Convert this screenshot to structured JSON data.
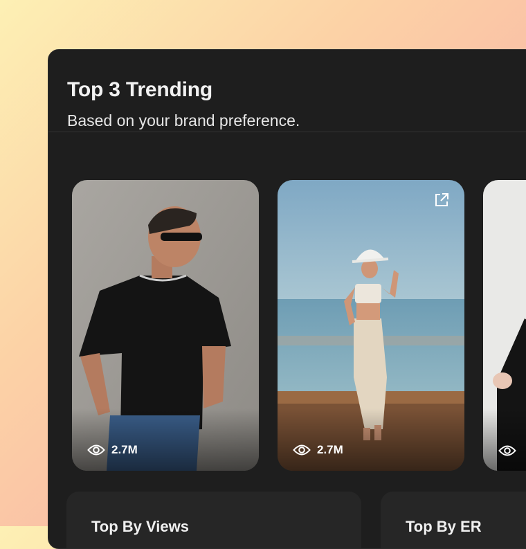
{
  "header": {
    "title": "Top 3 Trending",
    "subtitle": "Based on your brand preference."
  },
  "cards": [
    {
      "views": "2.7M",
      "icon": "eye-icon"
    },
    {
      "views": "2.7M",
      "icon": "eye-icon",
      "action_icon": "external-link-icon"
    },
    {
      "views": "",
      "icon": "eye-icon"
    }
  ],
  "bottom_cards": [
    {
      "label": "Top By Views"
    },
    {
      "label": "Top By ER"
    }
  ],
  "colors": {
    "panel": "#1e1e1e",
    "text": "#f2f2f2"
  }
}
